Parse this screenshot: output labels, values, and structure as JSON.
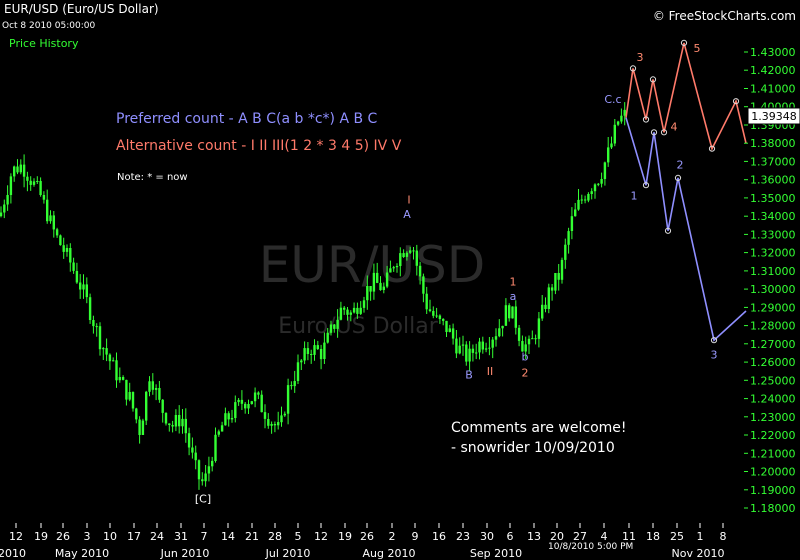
{
  "header": {
    "title": "EUR/USD (Euro/US Dollar)",
    "timestamp": "Oct 8 2010 05:00:00",
    "price_history_label": "Price History",
    "site": "© FreeStockCharts.com"
  },
  "watermark": {
    "symbol": "EUR/USD",
    "name": "Euro/US Dollar"
  },
  "annotations": {
    "preferred": "Preferred count -  A B C(a b *c*) A B C",
    "alternative": "Alternative count -  I II III(1 2 * 3 4 5) IV V",
    "note": "Note:  * = now",
    "comment_line1": "Comments are welcome!",
    "comment_line2": "- snowrider  10/09/2010"
  },
  "crosshair_label": "10/8/2010 5:00 PM",
  "current_price": "1.39348",
  "colors": {
    "candles": "#33ff33",
    "preferred": "#8f8fff",
    "alternative": "#ff7a6a",
    "background": "#000000"
  },
  "chart_data": {
    "type": "candlestick",
    "title": "EUR/USD (Euro/US Dollar)",
    "y_axis": {
      "ylim": [
        1.175,
        1.435
      ],
      "ticks": [
        "1.18000",
        "1.19000",
        "1.20000",
        "1.21000",
        "1.22000",
        "1.23000",
        "1.24000",
        "1.25000",
        "1.26000",
        "1.27000",
        "1.28000",
        "1.29000",
        "1.30000",
        "1.31000",
        "1.32000",
        "1.33000",
        "1.34000",
        "1.35000",
        "1.36000",
        "1.37000",
        "1.38000",
        "1.39000",
        "1.40000",
        "1.41000",
        "1.42000",
        "1.43000"
      ]
    },
    "x_axis": {
      "day_ticks": [
        "12",
        "19",
        "26",
        "3",
        "10",
        "17",
        "24",
        "31",
        "7",
        "14",
        "21",
        "28",
        "5",
        "12",
        "19",
        "26",
        "2",
        "9",
        "16",
        "23",
        "30",
        "6",
        "13",
        "20",
        "27",
        "4",
        "11",
        "18",
        "25",
        "1",
        "8"
      ],
      "months": [
        "2010",
        "May 2010",
        "Jun 2010",
        "Jul 2010",
        "Aug 2010",
        "Sep 2010",
        "Nov 2010"
      ]
    },
    "price_path": [
      [
        0,
        1.34
      ],
      [
        12,
        1.365
      ],
      [
        22,
        1.368
      ],
      [
        40,
        1.352
      ],
      [
        55,
        1.33
      ],
      [
        70,
        1.315
      ],
      [
        85,
        1.296
      ],
      [
        100,
        1.272
      ],
      [
        115,
        1.255
      ],
      [
        130,
        1.24
      ],
      [
        140,
        1.222
      ],
      [
        150,
        1.255
      ],
      [
        160,
        1.236
      ],
      [
        172,
        1.225
      ],
      [
        182,
        1.23
      ],
      [
        190,
        1.212
      ],
      [
        198,
        1.197
      ],
      [
        204,
        1.193
      ],
      [
        212,
        1.21
      ],
      [
        222,
        1.225
      ],
      [
        232,
        1.232
      ],
      [
        242,
        1.238
      ],
      [
        255,
        1.241
      ],
      [
        268,
        1.23
      ],
      [
        280,
        1.222
      ],
      [
        288,
        1.245
      ],
      [
        298,
        1.257
      ],
      [
        310,
        1.268
      ],
      [
        322,
        1.265
      ],
      [
        332,
        1.278
      ],
      [
        342,
        1.29
      ],
      [
        352,
        1.286
      ],
      [
        364,
        1.298
      ],
      [
        374,
        1.304
      ],
      [
        384,
        1.3
      ],
      [
        394,
        1.315
      ],
      [
        404,
        1.322
      ],
      [
        412,
        1.326
      ],
      [
        418,
        1.31
      ],
      [
        426,
        1.292
      ],
      [
        436,
        1.283
      ],
      [
        448,
        1.278
      ],
      [
        458,
        1.268
      ],
      [
        468,
        1.262
      ],
      [
        478,
        1.27
      ],
      [
        488,
        1.272
      ],
      [
        498,
        1.278
      ],
      [
        508,
        1.29
      ],
      [
        515,
        1.283
      ],
      [
        522,
        1.27
      ],
      [
        530,
        1.268
      ],
      [
        540,
        1.283
      ],
      [
        550,
        1.3
      ],
      [
        560,
        1.308
      ],
      [
        570,
        1.335
      ],
      [
        580,
        1.348
      ],
      [
        590,
        1.356
      ],
      [
        600,
        1.362
      ],
      [
        610,
        1.377
      ],
      [
        618,
        1.392
      ],
      [
        626,
        1.396
      ]
    ],
    "projections": {
      "preferred": [
        {
          "x": 626,
          "y": 1.394
        },
        {
          "x": 646,
          "y": 1.357,
          "label": "1"
        },
        {
          "x": 654,
          "y": 1.386
        },
        {
          "x": 668,
          "y": 1.332
        },
        {
          "x": 678,
          "y": 1.361,
          "label": "2"
        },
        {
          "x": 714,
          "y": 1.272,
          "label": "3"
        },
        {
          "x": 746,
          "y": 1.288
        }
      ],
      "alternative": [
        {
          "x": 626,
          "y": 1.394
        },
        {
          "x": 633,
          "y": 1.421,
          "label": "3"
        },
        {
          "x": 646,
          "y": 1.393
        },
        {
          "x": 653,
          "y": 1.415
        },
        {
          "x": 664,
          "y": 1.386,
          "label": "4"
        },
        {
          "x": 684,
          "y": 1.435,
          "label": "5"
        },
        {
          "x": 712,
          "y": 1.377
        },
        {
          "x": 736,
          "y": 1.403
        },
        {
          "x": 746,
          "y": 1.38
        }
      ]
    },
    "wave_labels": [
      {
        "text": "[C]",
        "x": 203,
        "y": 1.183,
        "kind": "white"
      },
      {
        "text": "I",
        "x": 409,
        "y": 1.347,
        "kind": "red"
      },
      {
        "text": "A",
        "x": 407,
        "y": 1.339,
        "kind": "blue"
      },
      {
        "text": "B",
        "x": 469,
        "y": 1.251,
        "kind": "blue"
      },
      {
        "text": "II",
        "x": 490,
        "y": 1.253,
        "kind": "red"
      },
      {
        "text": "1",
        "x": 513,
        "y": 1.302,
        "kind": "red"
      },
      {
        "text": "a",
        "x": 513,
        "y": 1.294,
        "kind": "blue"
      },
      {
        "text": "b",
        "x": 525,
        "y": 1.261,
        "kind": "blue"
      },
      {
        "text": "2",
        "x": 525,
        "y": 1.252,
        "kind": "red"
      },
      {
        "text": "C.c",
        "x": 613,
        "y": 1.402,
        "kind": "blue"
      },
      {
        "text": "3",
        "x": 640,
        "y": 1.425,
        "kind": "red"
      },
      {
        "text": "1",
        "x": 634,
        "y": 1.349,
        "kind": "blue"
      },
      {
        "text": "4",
        "x": 674,
        "y": 1.387,
        "kind": "red"
      },
      {
        "text": "2",
        "x": 680,
        "y": 1.366,
        "kind": "blue"
      },
      {
        "text": "5",
        "x": 697,
        "y": 1.43,
        "kind": "red"
      },
      {
        "text": "3",
        "x": 714,
        "y": 1.262,
        "kind": "blue"
      }
    ]
  }
}
